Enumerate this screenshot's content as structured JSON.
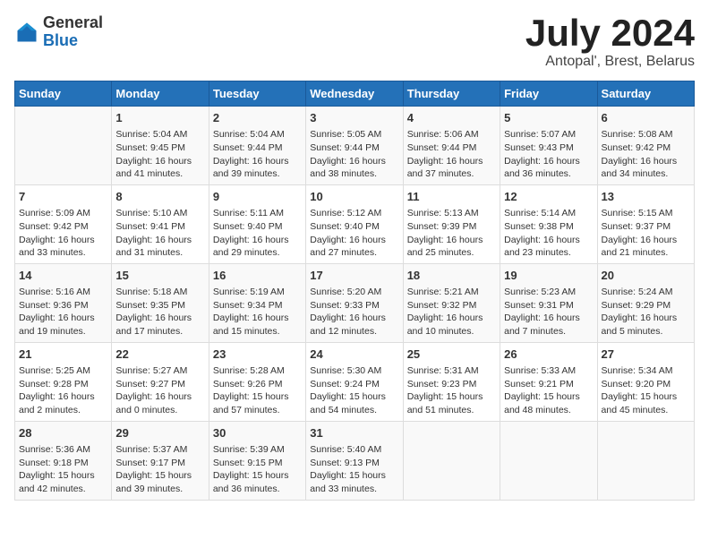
{
  "logo": {
    "general": "General",
    "blue": "Blue"
  },
  "title": {
    "month": "July 2024",
    "location": "Antopal', Brest, Belarus"
  },
  "calendar": {
    "headers": [
      "Sunday",
      "Monday",
      "Tuesday",
      "Wednesday",
      "Thursday",
      "Friday",
      "Saturday"
    ],
    "weeks": [
      [
        {
          "day": "",
          "info": ""
        },
        {
          "day": "1",
          "info": "Sunrise: 5:04 AM\nSunset: 9:45 PM\nDaylight: 16 hours\nand 41 minutes."
        },
        {
          "day": "2",
          "info": "Sunrise: 5:04 AM\nSunset: 9:44 PM\nDaylight: 16 hours\nand 39 minutes."
        },
        {
          "day": "3",
          "info": "Sunrise: 5:05 AM\nSunset: 9:44 PM\nDaylight: 16 hours\nand 38 minutes."
        },
        {
          "day": "4",
          "info": "Sunrise: 5:06 AM\nSunset: 9:44 PM\nDaylight: 16 hours\nand 37 minutes."
        },
        {
          "day": "5",
          "info": "Sunrise: 5:07 AM\nSunset: 9:43 PM\nDaylight: 16 hours\nand 36 minutes."
        },
        {
          "day": "6",
          "info": "Sunrise: 5:08 AM\nSunset: 9:42 PM\nDaylight: 16 hours\nand 34 minutes."
        }
      ],
      [
        {
          "day": "7",
          "info": "Sunrise: 5:09 AM\nSunset: 9:42 PM\nDaylight: 16 hours\nand 33 minutes."
        },
        {
          "day": "8",
          "info": "Sunrise: 5:10 AM\nSunset: 9:41 PM\nDaylight: 16 hours\nand 31 minutes."
        },
        {
          "day": "9",
          "info": "Sunrise: 5:11 AM\nSunset: 9:40 PM\nDaylight: 16 hours\nand 29 minutes."
        },
        {
          "day": "10",
          "info": "Sunrise: 5:12 AM\nSunset: 9:40 PM\nDaylight: 16 hours\nand 27 minutes."
        },
        {
          "day": "11",
          "info": "Sunrise: 5:13 AM\nSunset: 9:39 PM\nDaylight: 16 hours\nand 25 minutes."
        },
        {
          "day": "12",
          "info": "Sunrise: 5:14 AM\nSunset: 9:38 PM\nDaylight: 16 hours\nand 23 minutes."
        },
        {
          "day": "13",
          "info": "Sunrise: 5:15 AM\nSunset: 9:37 PM\nDaylight: 16 hours\nand 21 minutes."
        }
      ],
      [
        {
          "day": "14",
          "info": "Sunrise: 5:16 AM\nSunset: 9:36 PM\nDaylight: 16 hours\nand 19 minutes."
        },
        {
          "day": "15",
          "info": "Sunrise: 5:18 AM\nSunset: 9:35 PM\nDaylight: 16 hours\nand 17 minutes."
        },
        {
          "day": "16",
          "info": "Sunrise: 5:19 AM\nSunset: 9:34 PM\nDaylight: 16 hours\nand 15 minutes."
        },
        {
          "day": "17",
          "info": "Sunrise: 5:20 AM\nSunset: 9:33 PM\nDaylight: 16 hours\nand 12 minutes."
        },
        {
          "day": "18",
          "info": "Sunrise: 5:21 AM\nSunset: 9:32 PM\nDaylight: 16 hours\nand 10 minutes."
        },
        {
          "day": "19",
          "info": "Sunrise: 5:23 AM\nSunset: 9:31 PM\nDaylight: 16 hours\nand 7 minutes."
        },
        {
          "day": "20",
          "info": "Sunrise: 5:24 AM\nSunset: 9:29 PM\nDaylight: 16 hours\nand 5 minutes."
        }
      ],
      [
        {
          "day": "21",
          "info": "Sunrise: 5:25 AM\nSunset: 9:28 PM\nDaylight: 16 hours\nand 2 minutes."
        },
        {
          "day": "22",
          "info": "Sunrise: 5:27 AM\nSunset: 9:27 PM\nDaylight: 16 hours\nand 0 minutes."
        },
        {
          "day": "23",
          "info": "Sunrise: 5:28 AM\nSunset: 9:26 PM\nDaylight: 15 hours\nand 57 minutes."
        },
        {
          "day": "24",
          "info": "Sunrise: 5:30 AM\nSunset: 9:24 PM\nDaylight: 15 hours\nand 54 minutes."
        },
        {
          "day": "25",
          "info": "Sunrise: 5:31 AM\nSunset: 9:23 PM\nDaylight: 15 hours\nand 51 minutes."
        },
        {
          "day": "26",
          "info": "Sunrise: 5:33 AM\nSunset: 9:21 PM\nDaylight: 15 hours\nand 48 minutes."
        },
        {
          "day": "27",
          "info": "Sunrise: 5:34 AM\nSunset: 9:20 PM\nDaylight: 15 hours\nand 45 minutes."
        }
      ],
      [
        {
          "day": "28",
          "info": "Sunrise: 5:36 AM\nSunset: 9:18 PM\nDaylight: 15 hours\nand 42 minutes."
        },
        {
          "day": "29",
          "info": "Sunrise: 5:37 AM\nSunset: 9:17 PM\nDaylight: 15 hours\nand 39 minutes."
        },
        {
          "day": "30",
          "info": "Sunrise: 5:39 AM\nSunset: 9:15 PM\nDaylight: 15 hours\nand 36 minutes."
        },
        {
          "day": "31",
          "info": "Sunrise: 5:40 AM\nSunset: 9:13 PM\nDaylight: 15 hours\nand 33 minutes."
        },
        {
          "day": "",
          "info": ""
        },
        {
          "day": "",
          "info": ""
        },
        {
          "day": "",
          "info": ""
        }
      ]
    ]
  }
}
